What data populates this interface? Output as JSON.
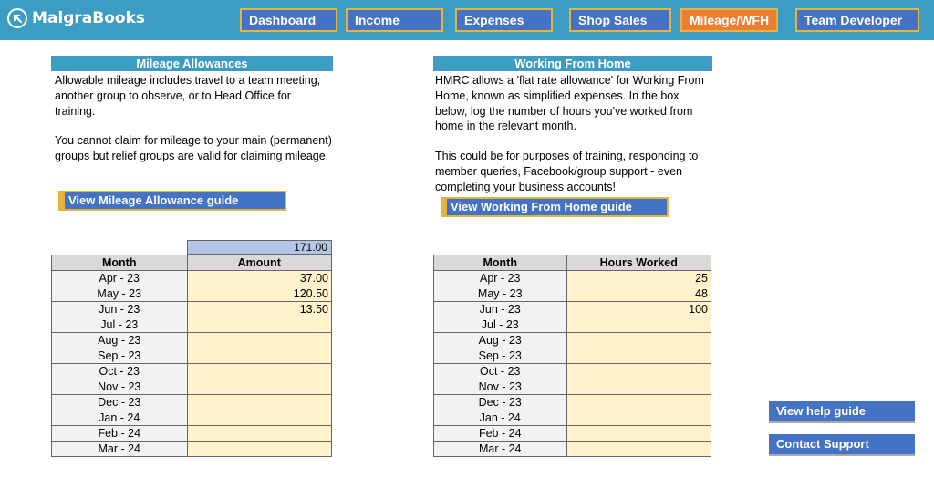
{
  "brand": {
    "name": "MalgraBooks"
  },
  "nav": [
    {
      "label": "Dashboard"
    },
    {
      "label": "Income"
    },
    {
      "label": "Expenses"
    },
    {
      "label": "Shop Sales"
    },
    {
      "label": "Mileage/WFH",
      "active": true
    },
    {
      "label": "Team Developer"
    }
  ],
  "mileage": {
    "heading": "Mileage Allowances",
    "paragraph1": "Allowable mileage includes travel to a team meeting, another group to observe, or to Head Office for training.",
    "paragraph2": "You cannot claim for mileage to your main (permanent) groups but relief groups are valid for claiming mileage.",
    "guide_button": "View Mileage Allowance guide",
    "total": "171.00",
    "col_month": "Month",
    "col_amount": "Amount",
    "rows": [
      {
        "month": "Apr - 23",
        "value": "37.00"
      },
      {
        "month": "May - 23",
        "value": "120.50"
      },
      {
        "month": "Jun - 23",
        "value": "13.50"
      },
      {
        "month": "Jul - 23",
        "value": ""
      },
      {
        "month": "Aug - 23",
        "value": ""
      },
      {
        "month": "Sep - 23",
        "value": ""
      },
      {
        "month": "Oct - 23",
        "value": ""
      },
      {
        "month": "Nov - 23",
        "value": ""
      },
      {
        "month": "Dec - 23",
        "value": ""
      },
      {
        "month": "Jan - 24",
        "value": ""
      },
      {
        "month": "Feb - 24",
        "value": ""
      },
      {
        "month": "Mar - 24",
        "value": ""
      }
    ]
  },
  "wfh": {
    "heading": "Working From Home",
    "paragraph1": "HMRC allows a 'flat rate allowance' for Working From Home, known as simplified expenses. In the box below, log the number of hours you've worked from home in the relevant month.",
    "paragraph2": "This could be for purposes of training, responding to member queries, Facebook/group support - even completing your business accounts!",
    "guide_button": "View Working From Home guide",
    "col_month": "Month",
    "col_hours": "Hours Worked",
    "rows": [
      {
        "month": "Apr - 23",
        "value": "25"
      },
      {
        "month": "May - 23",
        "value": "48"
      },
      {
        "month": "Jun - 23",
        "value": "100"
      },
      {
        "month": "Jul - 23",
        "value": ""
      },
      {
        "month": "Aug - 23",
        "value": ""
      },
      {
        "month": "Sep - 23",
        "value": ""
      },
      {
        "month": "Oct - 23",
        "value": ""
      },
      {
        "month": "Nov - 23",
        "value": ""
      },
      {
        "month": "Dec - 23",
        "value": ""
      },
      {
        "month": "Jan - 24",
        "value": ""
      },
      {
        "month": "Feb - 24",
        "value": ""
      },
      {
        "month": "Mar - 24",
        "value": ""
      }
    ]
  },
  "side": {
    "help_button": "View help guide",
    "support_button": "Contact Support"
  },
  "colors": {
    "header_bar": "#3d9cc3",
    "button_blue": "#4472c4",
    "active_tab": "#ed7d31",
    "button_border": "#e6b43c",
    "input_cell": "#fff2cc",
    "total_cell": "#b4c6e7"
  }
}
